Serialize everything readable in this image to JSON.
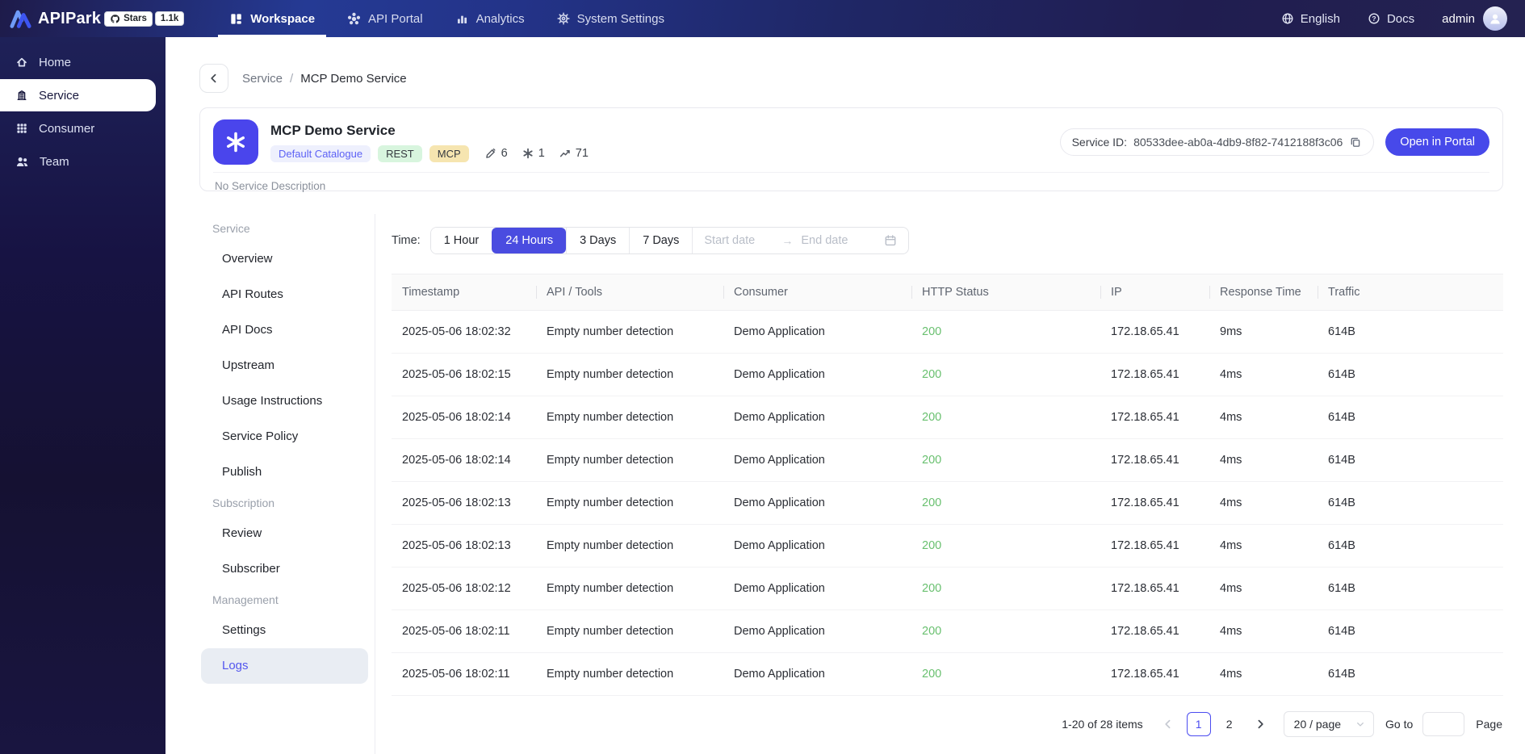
{
  "colors": {
    "primary": "#4a4ce0",
    "primary_button": "#4749ea",
    "service_icon_bg": "#4a45ec",
    "status_success": "#69c06f",
    "navbar_dark": "#1e1b4a",
    "navbar_blue": "#253a94",
    "badge_catalogue_bg": "#eef0fd",
    "badge_catalogue_text": "#5d62f5",
    "badge_rest_bg": "#d8f5de",
    "badge_mcp_bg": "#f6e5b0",
    "active_menu_bg": "#e9edf3"
  },
  "topnav": {
    "brand": {
      "name": "APIPark",
      "stars_label": "Stars",
      "stars_count": "1.1k",
      "logo_icon": "logo",
      "github_icon": "octocat"
    },
    "items": [
      {
        "label": "Workspace",
        "icon": "workspace",
        "active": true
      },
      {
        "label": "API Portal",
        "icon": "api-portal",
        "active": false
      },
      {
        "label": "Analytics",
        "icon": "analytics",
        "active": false
      },
      {
        "label": "System Settings",
        "icon": "gear",
        "active": false
      }
    ],
    "right_items": [
      {
        "label": "English",
        "icon": "globe"
      },
      {
        "label": "Docs",
        "icon": "help"
      }
    ],
    "user": {
      "name": "admin",
      "avatar_icon": "user"
    }
  },
  "sidebar": {
    "items": [
      {
        "label": "Home",
        "icon": "home",
        "active": false
      },
      {
        "label": "Service",
        "icon": "service",
        "active": true
      },
      {
        "label": "Consumer",
        "icon": "consumer",
        "active": false
      },
      {
        "label": "Team",
        "icon": "team",
        "active": false
      }
    ]
  },
  "breadcrumb": {
    "back_icon": "chevron-left",
    "parent": "Service",
    "separator": "/",
    "current": "MCP Demo Service"
  },
  "service_header": {
    "logo_icon": "mcp",
    "title": "MCP Demo Service",
    "catalogue_badge": "Default Catalogue",
    "type_badges": [
      "REST",
      "MCP"
    ],
    "stats": [
      {
        "icon": "pen",
        "value": "6"
      },
      {
        "icon": "mcp",
        "value": "1"
      },
      {
        "icon": "trend",
        "value": "71"
      }
    ],
    "description": "No Service Description",
    "service_id_label": "Service ID:",
    "service_id": "80533dee-ab0a-4db9-8f82-7412188f3c06",
    "copy_icon": "copy",
    "open_portal_label": "Open in Portal"
  },
  "menu": {
    "groups": [
      {
        "label": "Service",
        "items": [
          {
            "label": "Overview",
            "active": false
          },
          {
            "label": "API Routes",
            "active": false
          },
          {
            "label": "API Docs",
            "active": false
          },
          {
            "label": "Upstream",
            "active": false
          },
          {
            "label": "Usage Instructions",
            "active": false
          },
          {
            "label": "Service Policy",
            "active": false
          },
          {
            "label": "Publish",
            "active": false
          }
        ]
      },
      {
        "label": "Subscription",
        "items": [
          {
            "label": "Review",
            "active": false
          },
          {
            "label": "Subscriber",
            "active": false
          }
        ]
      },
      {
        "label": "Management",
        "items": [
          {
            "label": "Settings",
            "active": false
          },
          {
            "label": "Logs",
            "active": true
          }
        ]
      }
    ]
  },
  "filters": {
    "time_label": "Time:",
    "options": [
      {
        "label": "1 Hour",
        "active": false
      },
      {
        "label": "24 Hours",
        "active": true
      },
      {
        "label": "3 Days",
        "active": false
      },
      {
        "label": "7 Days",
        "active": false
      }
    ],
    "date_range": {
      "start_placeholder": "Start date",
      "end_placeholder": "End date",
      "arrow": "→",
      "calendar_icon": "calendar"
    }
  },
  "table": {
    "columns": [
      "Timestamp",
      "API / Tools",
      "Consumer",
      "HTTP Status",
      "IP",
      "Response Time",
      "Traffic"
    ],
    "status_column_index": 3,
    "rows": [
      [
        "2025-05-06 18:02:32",
        "Empty number detection",
        "Demo Application",
        "200",
        "172.18.65.41",
        "9ms",
        "614B"
      ],
      [
        "2025-05-06 18:02:15",
        "Empty number detection",
        "Demo Application",
        "200",
        "172.18.65.41",
        "4ms",
        "614B"
      ],
      [
        "2025-05-06 18:02:14",
        "Empty number detection",
        "Demo Application",
        "200",
        "172.18.65.41",
        "4ms",
        "614B"
      ],
      [
        "2025-05-06 18:02:14",
        "Empty number detection",
        "Demo Application",
        "200",
        "172.18.65.41",
        "4ms",
        "614B"
      ],
      [
        "2025-05-06 18:02:13",
        "Empty number detection",
        "Demo Application",
        "200",
        "172.18.65.41",
        "4ms",
        "614B"
      ],
      [
        "2025-05-06 18:02:13",
        "Empty number detection",
        "Demo Application",
        "200",
        "172.18.65.41",
        "4ms",
        "614B"
      ],
      [
        "2025-05-06 18:02:12",
        "Empty number detection",
        "Demo Application",
        "200",
        "172.18.65.41",
        "4ms",
        "614B"
      ],
      [
        "2025-05-06 18:02:11",
        "Empty number detection",
        "Demo Application",
        "200",
        "172.18.65.41",
        "4ms",
        "614B"
      ],
      [
        "2025-05-06 18:02:11",
        "Empty number detection",
        "Demo Application",
        "200",
        "172.18.65.41",
        "4ms",
        "614B"
      ]
    ]
  },
  "pagination": {
    "summary": "1-20 of 28 items",
    "prev_icon": "chevron-left",
    "next_icon": "chevron-right",
    "pages": [
      "1",
      "2"
    ],
    "active_page": "1",
    "page_size": "20 / page",
    "size_icon": "chevron-down",
    "goto_label": "Go to",
    "goto_value": "",
    "page_label": "Page"
  }
}
